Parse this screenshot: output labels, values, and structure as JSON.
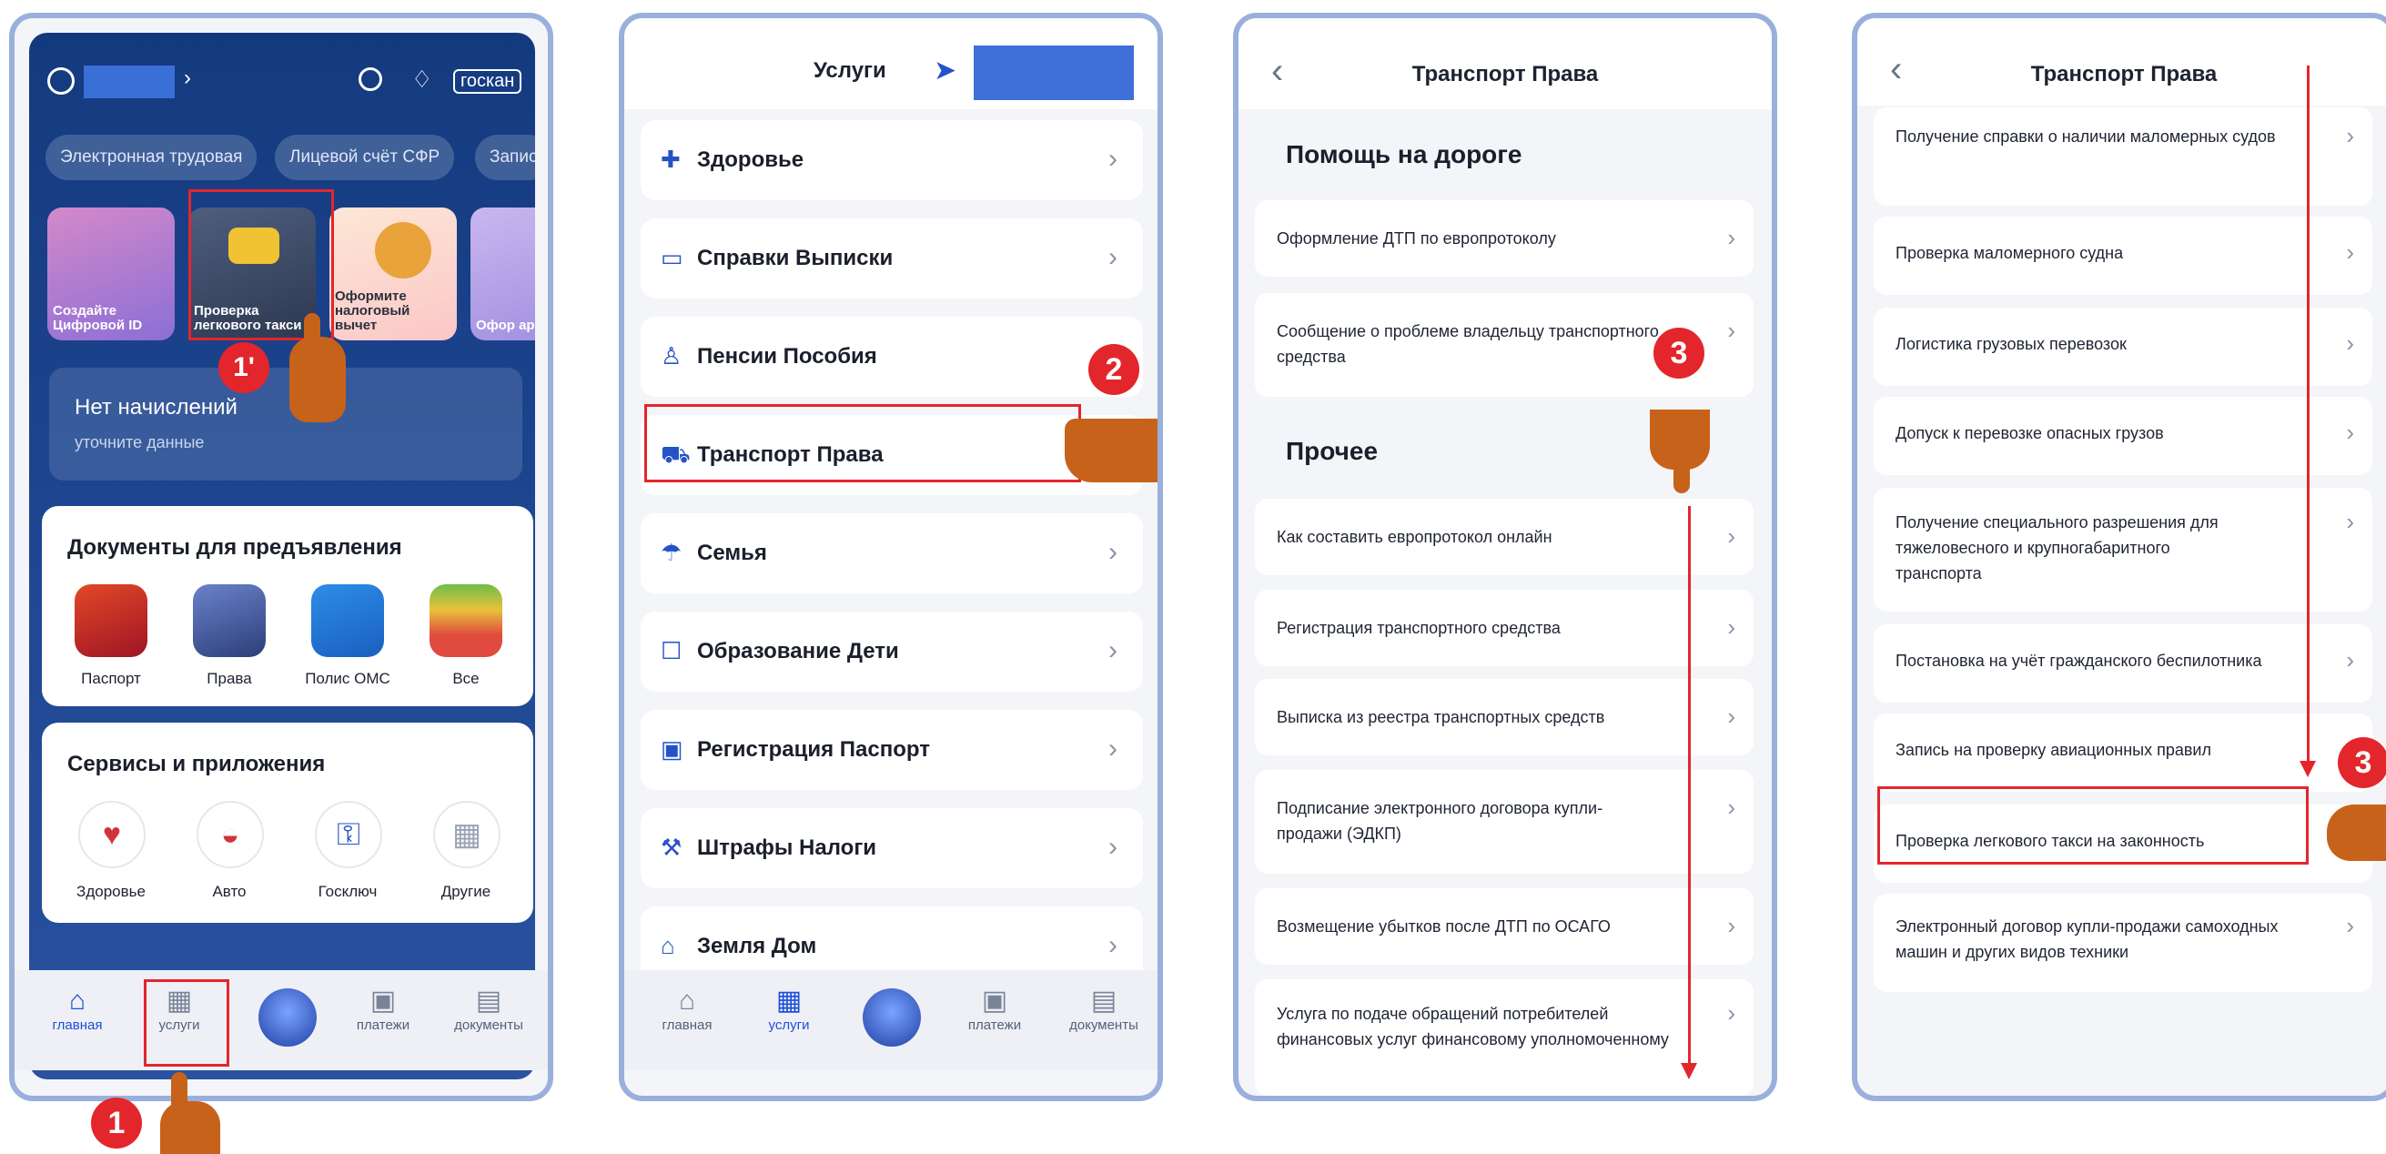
{
  "screen1": {
    "chips": [
      "Электронная трудовая",
      "Лицевой счёт СФР",
      "Запис"
    ],
    "gosuslugi_logo": "госкан",
    "tiles": [
      {
        "label": "Создайте Цифровой ID"
      },
      {
        "label": "Проверка легкового такси"
      },
      {
        "label": "Оформите налоговый вычет"
      },
      {
        "label": "Офор аренд"
      }
    ],
    "charges": {
      "title": "Нет начислений",
      "subtitle": "уточните данные"
    },
    "documents": {
      "title": "Документы для предъявления",
      "items": [
        "Паспорт",
        "Права",
        "Полис ОМС",
        "Все"
      ]
    },
    "services": {
      "title": "Сервисы и приложения",
      "items": [
        "Здоровье",
        "Авто",
        "Госключ",
        "Другие"
      ]
    },
    "tabbar": [
      "главная",
      "услуги",
      "платежи",
      "документы"
    ],
    "badge_main": "1",
    "badge_tile": "1'"
  },
  "screen2": {
    "title": "Услуги",
    "items": [
      "Здоровье",
      "Справки Выписки",
      "Пенсии Пособия",
      "Транспорт Права",
      "Семья",
      "Образование Дети",
      "Регистрация Паспорт",
      "Штрафы Налоги",
      "Земля Дом"
    ],
    "tabbar": [
      "главная",
      "услуги",
      "платежи",
      "документы"
    ],
    "badge": "2"
  },
  "screen3": {
    "title": "Транспорт Права",
    "section1": "Помощь на дороге",
    "section1_items": [
      "Оформление ДТП по европротоколу",
      "Сообщение о проблеме владельцу транспортного средства"
    ],
    "section2": "Прочее",
    "section2_items": [
      "Как составить европротокол онлайн",
      "Регистрация транспортного средства",
      "Выписка из реестра транспортных средств",
      "Подписание электронного договора купли-продажи (ЭДКП)",
      "Возмещение убытков после ДТП по ОСАГО",
      "Услуга по подаче обращений потребителей финансовых услуг финансовому уполномоченному"
    ],
    "badge": "3"
  },
  "screen4": {
    "title": "Транспорт Права",
    "items": [
      "Получение справки о наличии маломерных судов",
      "Проверка маломерного судна",
      "Логистика грузовых перевозок",
      "Допуск к перевозке опасных грузов",
      "Получение специального разрешения для тяжеловесного и крупногабаритного транспорта",
      "Постановка на учёт гражданского беспилотника",
      "Запись на проверку авиационных правил",
      "Проверка легкового такси на законность",
      "Электронный договор купли-продажи самоходных машин и других видов техники"
    ],
    "badge": "3"
  },
  "colors": {
    "accent": "#1d4ed8",
    "highlight": "#e3262b",
    "hand": "#c7621b",
    "frame": "#9ab0dc"
  }
}
